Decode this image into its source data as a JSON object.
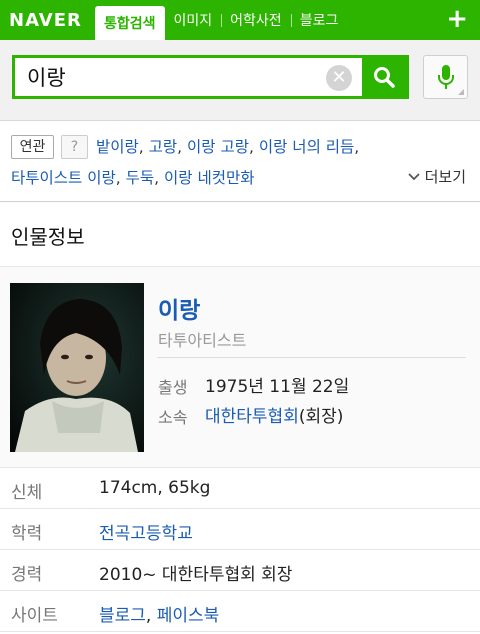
{
  "header": {
    "logo": "NAVER",
    "tabs": [
      {
        "label": "통합검색"
      },
      {
        "label": "이미지"
      },
      {
        "label": "어학사전"
      },
      {
        "label": "블로그"
      }
    ],
    "plus": "+"
  },
  "search": {
    "query": "이랑",
    "clear": "✕"
  },
  "related": {
    "tag": "연관",
    "help": "?",
    "line1": [
      "밭이랑",
      "고랑",
      "이랑 고랑",
      "이랑 너의 리듬"
    ],
    "line2": [
      "타투이스트 이랑",
      "두둑",
      "이랑 네컷만화"
    ],
    "more": "더보기"
  },
  "person": {
    "section_title": "인물정보",
    "name": "이랑",
    "job": "타투아티스트",
    "birth_label": "출생",
    "birth_value": "1975년 11월 22일",
    "affil_label": "소속",
    "affil_link": "대한타투협회",
    "affil_suffix": "(회장)",
    "rows": [
      {
        "key": "신체",
        "value": "174cm, 65kg"
      },
      {
        "key": "학력",
        "link": "전곡고등학교"
      },
      {
        "key": "경력",
        "value": "2010~ 대한타투협회 회장"
      },
      {
        "key": "사이트",
        "link1": "블로그",
        "sep": ", ",
        "link2": "페이스북"
      }
    ]
  },
  "colors": {
    "brand": "#2db400",
    "link": "#1a5cb2"
  }
}
